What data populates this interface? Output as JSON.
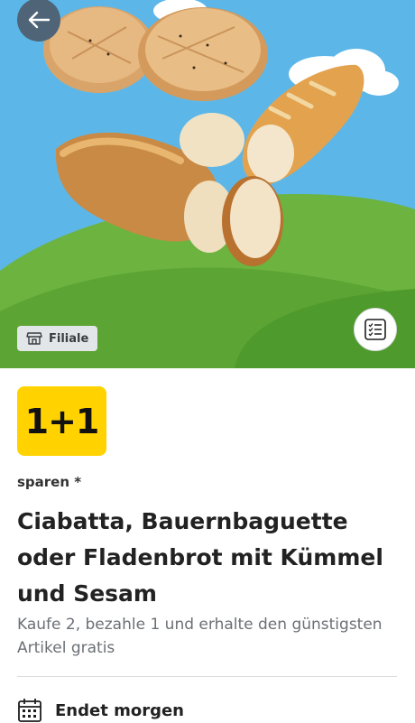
{
  "hero": {
    "image_icon": "bread-assortment-image",
    "back_icon": "arrow-left-icon",
    "store_chip_label": "Filiale",
    "store_chip_icon": "store-icon",
    "list_icon": "checklist-icon"
  },
  "offer": {
    "badge": "1+1",
    "savings_label": "sparen *",
    "title": "Ciabatta, Bauernbaguette oder Fladenbrot mit Kümmel und Sesam",
    "description": "Kaufe 2, bezahle 1 und erhalte den günstigsten Artikel gratis",
    "ends_label": "Endet morgen",
    "ends_icon": "calendar-icon"
  },
  "colors": {
    "badge_bg": "#ffd200",
    "sky": "#5cb7e8",
    "grass": "#6cb33f",
    "back_button": "#4f6577"
  }
}
